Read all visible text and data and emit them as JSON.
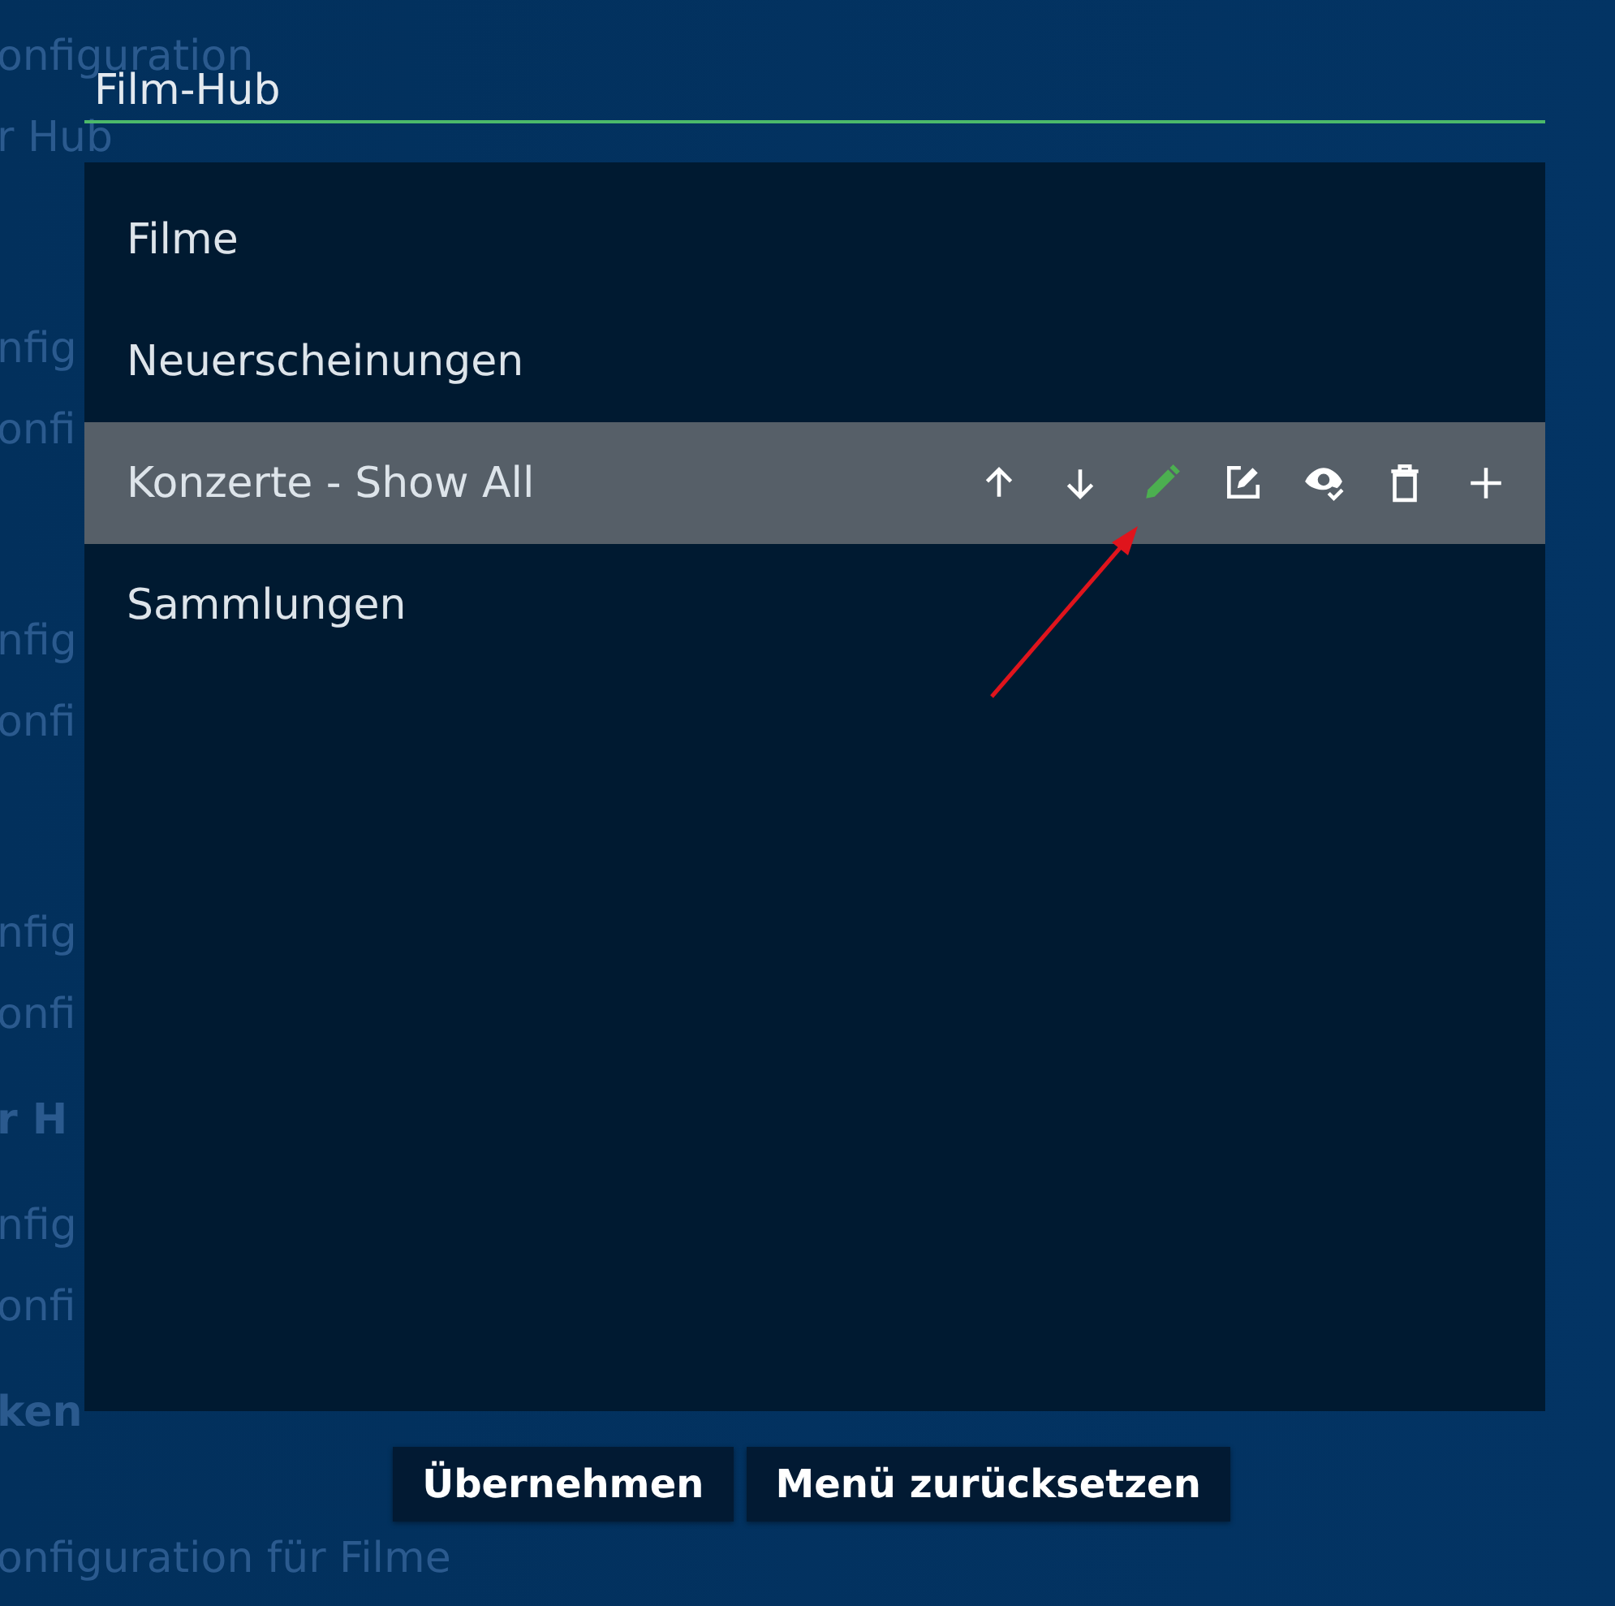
{
  "background_page": {
    "lines": [
      {
        "text": "onfiguration",
        "kind": "line"
      },
      {
        "text": "r Hub",
        "kind": "line"
      },
      {
        "text": "nfig",
        "kind": "line"
      },
      {
        "text": "onfi",
        "kind": "line"
      },
      {
        "text": "nfig",
        "kind": "line"
      },
      {
        "text": "onfi",
        "kind": "line"
      },
      {
        "text": "nfig",
        "kind": "line"
      },
      {
        "text": "onfi",
        "kind": "line"
      },
      {
        "text": "r H",
        "kind": "heading"
      },
      {
        "text": "nfig",
        "kind": "line"
      },
      {
        "text": "onfi",
        "kind": "line"
      },
      {
        "text": "ken",
        "kind": "heading"
      },
      {
        "text": "onfiguration für Filme",
        "kind": "line"
      }
    ]
  },
  "dialog": {
    "name_field": {
      "value": "Film-Hub"
    },
    "menu_items": [
      {
        "label": "Filme",
        "selected": false
      },
      {
        "label": "Neuerscheinungen",
        "selected": false
      },
      {
        "label": "Konzerte - Show All",
        "selected": true
      },
      {
        "label": "Sammlungen",
        "selected": false
      }
    ],
    "row_actions": [
      {
        "kind": "up",
        "highlighted": false
      },
      {
        "kind": "down",
        "highlighted": false
      },
      {
        "kind": "rename",
        "highlighted": true
      },
      {
        "kind": "edit",
        "highlighted": false
      },
      {
        "kind": "visibility",
        "highlighted": false
      },
      {
        "kind": "delete",
        "highlighted": false
      },
      {
        "kind": "add",
        "highlighted": false
      }
    ],
    "buttons": [
      {
        "label": "Übernehmen"
      },
      {
        "label": "Menü zurücksetzen"
      }
    ]
  }
}
